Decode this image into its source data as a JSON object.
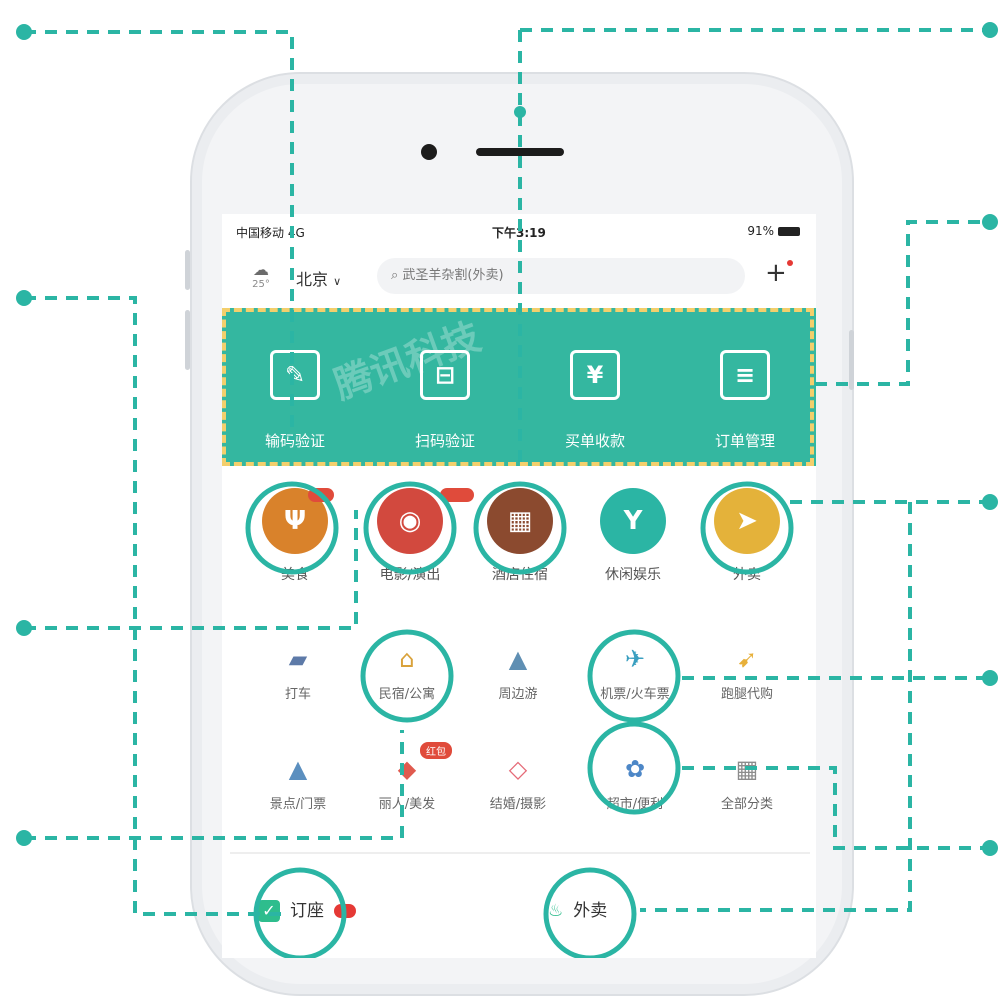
{
  "status_bar": {
    "carrier": "中国移动 4G",
    "time": "下午3:19",
    "battery": "91%"
  },
  "header": {
    "temperature": "25°",
    "city": "北京",
    "search_placeholder": "武圣羊杂割(外卖)",
    "plus_label": "+"
  },
  "merchant_tools": [
    {
      "label": "输码验证",
      "icon": "edit-code-icon",
      "glyph": "✎"
    },
    {
      "label": "扫码验证",
      "icon": "scan-icon",
      "glyph": "⊟"
    },
    {
      "label": "买单收款",
      "icon": "payment-icon",
      "glyph": "¥"
    },
    {
      "label": "订单管理",
      "icon": "order-list-icon",
      "glyph": "≡"
    }
  ],
  "watermark": "腾讯科技",
  "main_categories": [
    {
      "label": "美食",
      "icon": "food-icon",
      "color": "#d9822b",
      "glyph": "Ψ"
    },
    {
      "label": "电影/演出",
      "icon": "movie-icon",
      "color": "#d2493e",
      "glyph": "◉"
    },
    {
      "label": "酒店住宿",
      "icon": "hotel-icon",
      "color": "#8b4a2f",
      "glyph": "▦"
    },
    {
      "label": "休闲娱乐",
      "icon": "cocktail-icon",
      "color": "#2bb5a4",
      "glyph": "Y"
    },
    {
      "label": "外卖",
      "icon": "takeout-icon",
      "color": "#e4b23a",
      "glyph": "➤"
    }
  ],
  "sub_categories_row1": [
    {
      "label": "打车",
      "icon": "car-icon",
      "glyph": "🚗",
      "color": "#5d7aa8"
    },
    {
      "label": "民宿/公寓",
      "icon": "house-icon",
      "glyph": "⌂",
      "color": "#d9a23b"
    },
    {
      "label": "周边游",
      "icon": "mountain-icon",
      "glyph": "▲",
      "color": "#5f8fb3"
    },
    {
      "label": "机票/火车票",
      "icon": "plane-icon",
      "glyph": "✈",
      "color": "#3a9fc0"
    },
    {
      "label": "跑腿代购",
      "icon": "runner-icon",
      "glyph": "➹",
      "color": "#e7b03a"
    }
  ],
  "sub_categories_row2": [
    {
      "label": "景点/门票",
      "icon": "landmark-icon",
      "glyph": "▲",
      "color": "#5b8fbf"
    },
    {
      "label": "丽人/美发",
      "icon": "beauty-icon",
      "glyph": "◆",
      "color": "#e05a4e"
    },
    {
      "label": "结婚/摄影",
      "icon": "diamond-icon",
      "glyph": "◇",
      "color": "#e56b78"
    },
    {
      "label": "超市/便利",
      "icon": "market-icon",
      "glyph": "✿",
      "color": "#4d87c7"
    },
    {
      "label": "全部分类",
      "icon": "grid-icon",
      "glyph": "▦",
      "color": "#8c8c8c"
    }
  ],
  "badges": {
    "beauty": "红包"
  },
  "bottom_tabs": [
    {
      "label": "订座",
      "icon": "check-icon"
    },
    {
      "label": "外卖",
      "icon": "takeout-logo-icon",
      "glyph": "♨"
    }
  ],
  "colors": {
    "accent": "#34b7a0",
    "annotation": "#2bb5a4",
    "dashed_frame": "#f3cf6c"
  }
}
